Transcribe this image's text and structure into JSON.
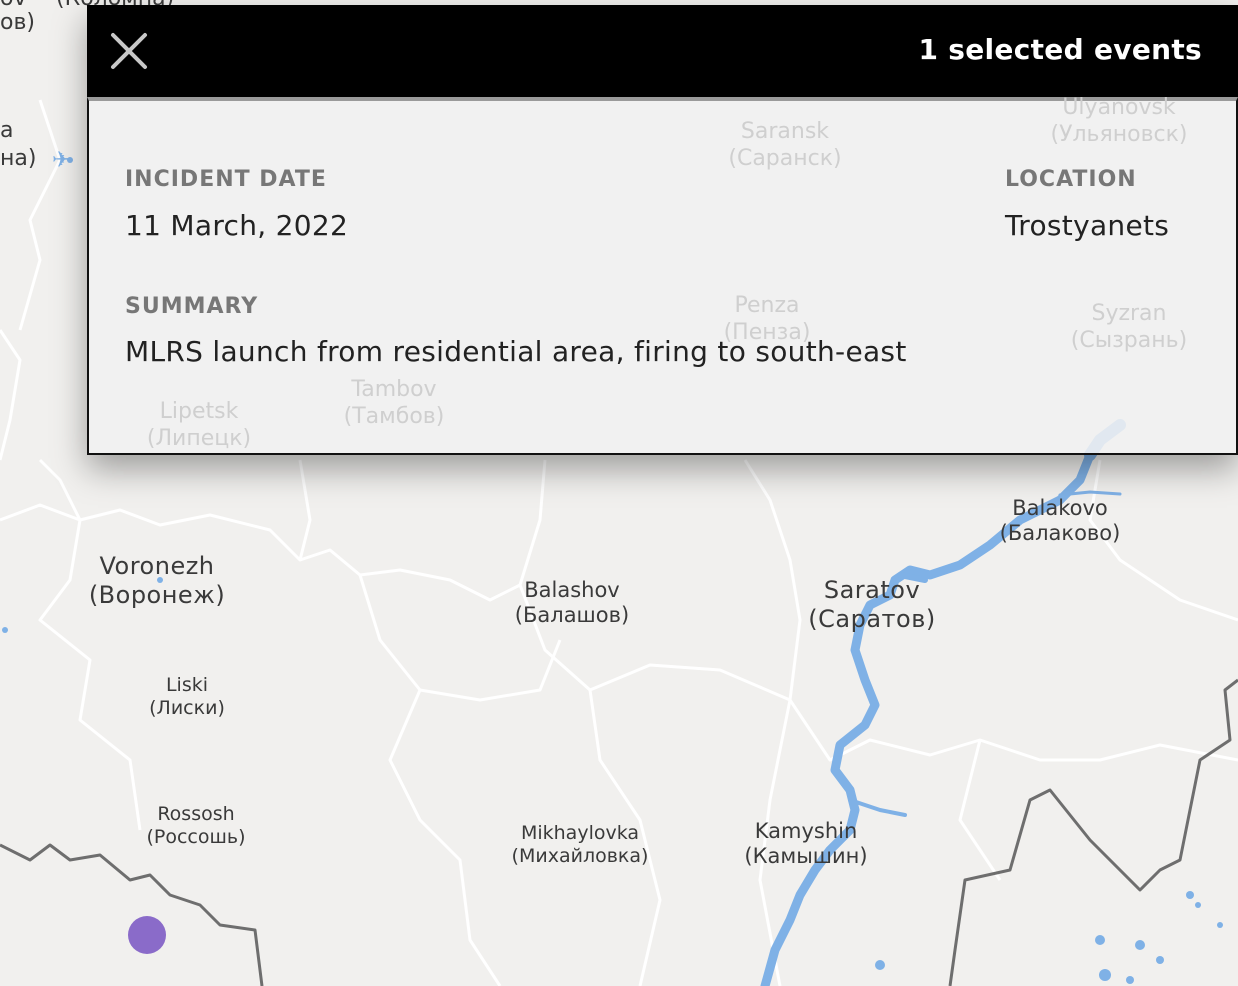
{
  "popup": {
    "title": "1 selected events",
    "close_icon": "close-icon",
    "fields": {
      "incident_date_label": "INCIDENT DATE",
      "incident_date_value": "11 March, 2022",
      "location_label": "LOCATION",
      "location_value": "Trostyanets",
      "summary_label": "SUMMARY",
      "summary_value": "MLRS launch from residential area, firing to south-east"
    }
  },
  "map": {
    "edge_labels": {
      "top_left_ov": "ov",
      "top_left_ov_ru": "ов)",
      "top_left_kolomna": "(Коломна)",
      "left_a": "a",
      "left_a_ru": "на)"
    },
    "cities": [
      {
        "key": "voronezh",
        "name": "Voronezh",
        "name_ru": "(Воронеж)"
      },
      {
        "key": "balashov",
        "name": "Balashov",
        "name_ru": "(Балашов)"
      },
      {
        "key": "saratov",
        "name": "Saratov",
        "name_ru": "(Саратов)"
      },
      {
        "key": "balakovo",
        "name": "Balakovo",
        "name_ru": "(Балаково)"
      },
      {
        "key": "liski",
        "name": "Liski",
        "name_ru": "(Лиски)"
      },
      {
        "key": "rossosh",
        "name": "Rossosh",
        "name_ru": "(Россошь)"
      },
      {
        "key": "mikhaylovka",
        "name": "Mikhaylovka",
        "name_ru": "(Михайловка)"
      },
      {
        "key": "kamyshin",
        "name": "Kamyshin",
        "name_ru": "(Камышин)"
      },
      {
        "key": "lipetsk",
        "name": "Lipetsk",
        "name_ru": "(Липецк)"
      },
      {
        "key": "tambov",
        "name": "Tambov",
        "name_ru": "(Тамбов)"
      }
    ],
    "faded_cities": [
      {
        "key": "saransk",
        "name": "Saransk",
        "name_ru": "(Саранск)"
      },
      {
        "key": "ulyanovsk",
        "name": "Ulyanovsk",
        "name_ru": "(Ульяновск)"
      },
      {
        "key": "penza",
        "name": "Penza",
        "name_ru": "(Пенза)"
      },
      {
        "key": "syzran",
        "name": "Syzran",
        "name_ru": "(Сызрань)"
      }
    ],
    "event_color": "#8a6bc9",
    "water_color": "#7fb1e6",
    "border_color": "#6b6b6b",
    "region_border_color": "#ffffff"
  }
}
